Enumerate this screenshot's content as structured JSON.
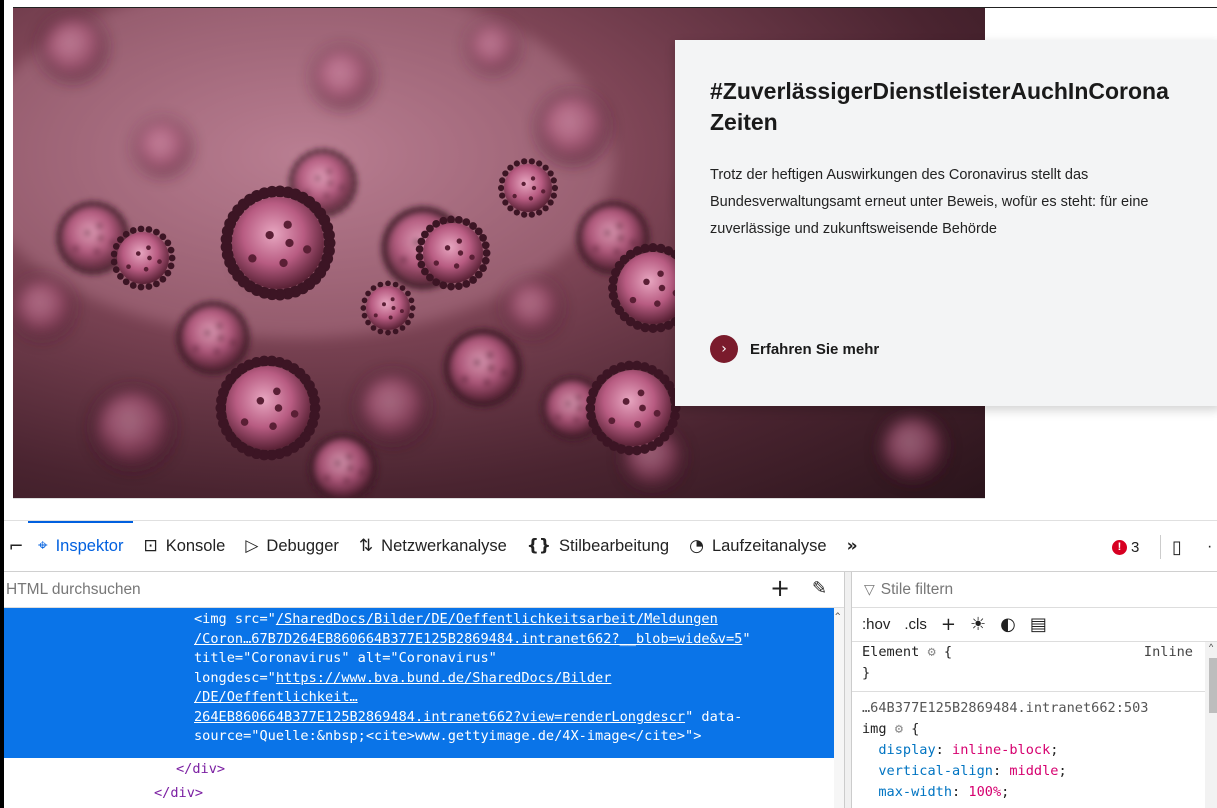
{
  "teaser": {
    "title": "#ZuverlässigerDienstleisterAuchInCoronaZeiten",
    "text": "Trotz der heftigen Auswirkungen des Coronavirus stellt das Bundesverwaltungsamt erneut unter Beweis, wofür es steht: für eine zuverlässige und zukunftsweisende Behörde",
    "more_label": "Erfahren Sie mehr"
  },
  "devtools": {
    "tabs": [
      {
        "icon": "inspector-icon",
        "label": "Inspektor",
        "active": true
      },
      {
        "icon": "console-icon",
        "label": "Konsole"
      },
      {
        "icon": "debugger-icon",
        "label": "Debugger"
      },
      {
        "icon": "network-icon",
        "label": "Netzwerkanalyse"
      },
      {
        "icon": "style-editor-icon",
        "label": "Stilbearbeitung"
      },
      {
        "icon": "performance-icon",
        "label": "Laufzeitanalyse"
      }
    ],
    "error_count": "3",
    "search_placeholder": "HTML durchsuchen",
    "filter_placeholder": "Stile filtern",
    "rule_tools": {
      "hov": ":hov",
      "cls": ".cls"
    },
    "markup": {
      "l1_pre": "<img src=\"",
      "l1_link": "/SharedDocs/Bilder/DE/Oeffentlichkeitsarbeit/Meldungen",
      "l2_link": "/Coron…67B7D264EB860664B377E125B2869484.intranet662?__blob=wide&v=5",
      "l2_post": "\"",
      "l3": "title=\"Coronavirus\" alt=\"Coronavirus\"",
      "l4_pre": "longdesc=\"",
      "l4_link": "https://www.bva.bund.de/SharedDocs/Bilder",
      "l5_link": "/DE/Oeffentlichkeit…",
      "l6_link": "264EB860664B377E125B2869484.intranet662?view=renderLongdescr",
      "l6_post": "\" data-",
      "l7": "source=\"Quelle:&nbsp;<cite>www.gettyimage.de/4X-image</cite>\">",
      "close1": "</div>",
      "close2": "</div>"
    },
    "rules": {
      "element_sel": "Element",
      "brace_open": "{",
      "brace_close": "}",
      "inline": "Inline",
      "source": "…64B377E125B2869484.intranet662:503",
      "img_sel": "img",
      "decls": [
        {
          "prop": "display",
          "val": "inline-block"
        },
        {
          "prop": "vertical-align",
          "val": "middle"
        },
        {
          "prop": "max-width",
          "val": "100%"
        }
      ]
    }
  }
}
